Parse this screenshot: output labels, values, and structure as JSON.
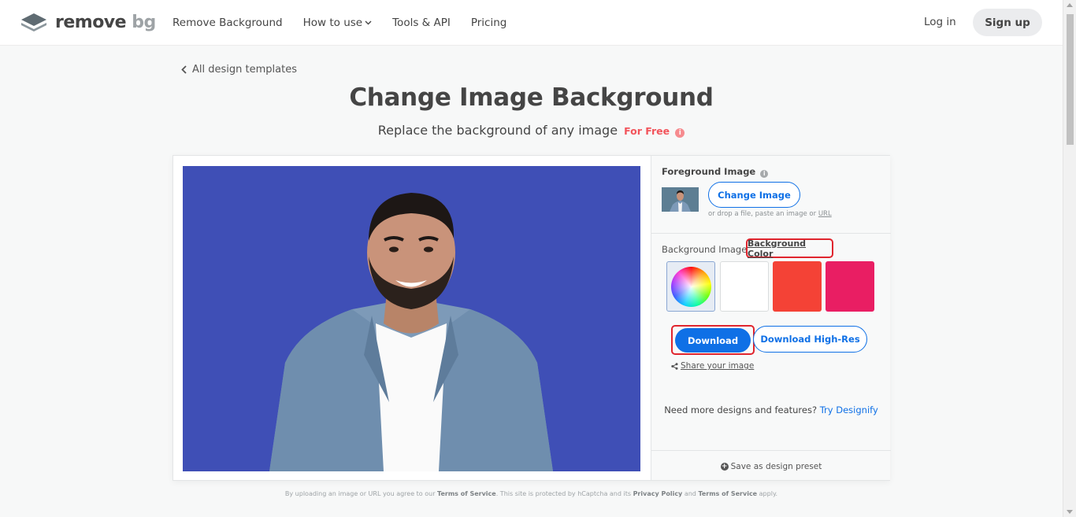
{
  "brand": {
    "name_main": "remove",
    "name_suffix": "bg"
  },
  "nav": {
    "items": [
      {
        "label": "Remove Background"
      },
      {
        "label": "How to use"
      },
      {
        "label": "Tools & API"
      },
      {
        "label": "Pricing"
      }
    ],
    "login": "Log in",
    "signup": "Sign up"
  },
  "back_link": "All design templates",
  "hero": {
    "title": "Change Image Background",
    "subtitle": "Replace the background of any image",
    "free_badge": "For Free"
  },
  "editor": {
    "preview_bg_color": "#3f4fb6",
    "foreground": {
      "label": "Foreground Image",
      "change_button": "Change Image",
      "drop_hint": "or drop a file, paste an image or",
      "drop_hint_link": "URL"
    },
    "background": {
      "tab_image": "Background Image",
      "tab_color": "Background Color",
      "swatches": [
        {
          "name": "color-picker"
        },
        {
          "name": "white",
          "color": "#ffffff"
        },
        {
          "name": "red",
          "color": "#f44236"
        },
        {
          "name": "pink",
          "color": "#e91e63"
        }
      ]
    },
    "download": "Download",
    "download_hr": "Download High-Res",
    "share": "Share your image",
    "more_text": "Need more designs and features?",
    "more_link": "Try Designify",
    "save_preset": "Save as design preset"
  },
  "footer": {
    "prefix": "By uploading an image or URL you agree to our",
    "tos": "Terms of Service",
    "middle": ". This site is protected by hCaptcha and its",
    "privacy": "Privacy Policy",
    "and": "and",
    "tos2": "Terms of Service",
    "suffix": "apply."
  },
  "colors": {
    "accent": "#0f70e6",
    "highlight": "#e0252e",
    "free": "#f2545b"
  }
}
